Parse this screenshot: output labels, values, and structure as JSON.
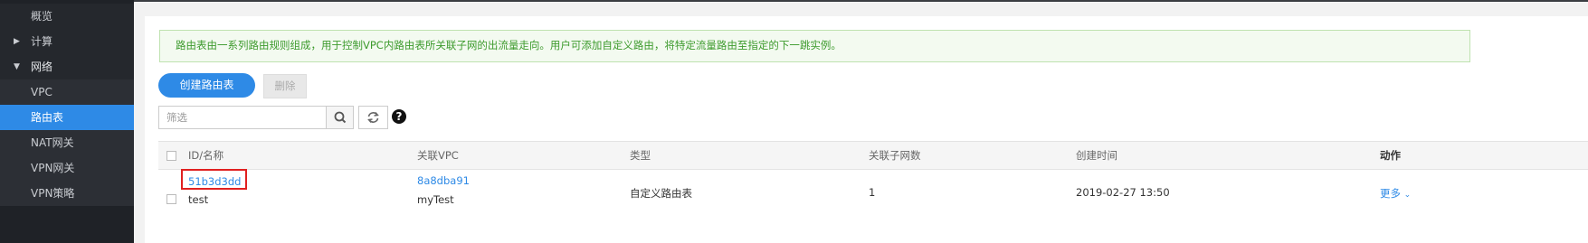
{
  "sidebar": {
    "items": [
      {
        "label": "概览"
      },
      {
        "label": "计算"
      },
      {
        "label": "网络"
      },
      {
        "label": "VPC"
      },
      {
        "label": "路由表"
      },
      {
        "label": "NAT网关"
      },
      {
        "label": "VPN网关"
      },
      {
        "label": "VPN策略"
      }
    ]
  },
  "notice": {
    "text": "路由表由一系列路由规则组成，用于控制VPC内路由表所关联子网的出流量走向。用户可添加自定义路由，将特定流量路由至指定的下一跳实例。"
  },
  "toolbar": {
    "create_label": "创建路由表",
    "delete_label": "删除",
    "filter_placeholder": "筛选",
    "help_label": "?"
  },
  "table": {
    "headers": {
      "id_name": "ID/名称",
      "vpc": "关联VPC",
      "type": "类型",
      "subnets": "关联子网数",
      "created": "创建时间",
      "action": "动作"
    },
    "rows": [
      {
        "id": "51b3d3dd",
        "name": "test",
        "vpc_id": "8a8dba91",
        "vpc_name": "myTest",
        "type": "自定义路由表",
        "subnets": "1",
        "created": "2019-02-27 13:50",
        "action": "更多"
      }
    ]
  },
  "colors": {
    "primary": "#2e8ae6",
    "sidebar_bg": "#1f2227",
    "notice_text": "#3c9a2c",
    "highlight": "#e02020"
  }
}
